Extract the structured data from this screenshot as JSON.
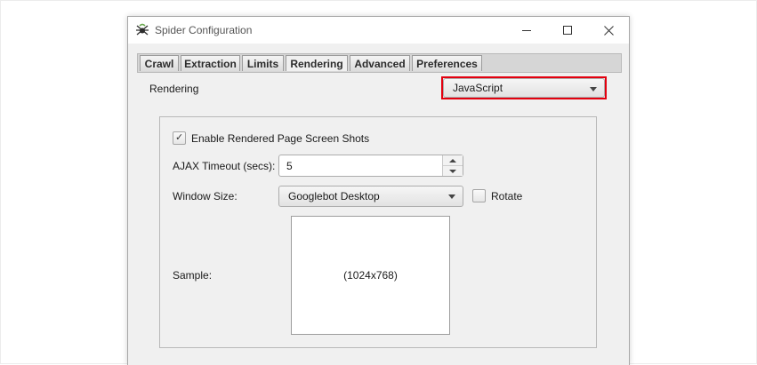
{
  "window": {
    "title": "Spider Configuration",
    "icon": "spider-icon"
  },
  "tabs": [
    {
      "label": "Crawl",
      "active": false
    },
    {
      "label": "Extraction",
      "active": false
    },
    {
      "label": "Limits",
      "active": false
    },
    {
      "label": "Rendering",
      "active": true
    },
    {
      "label": "Advanced",
      "active": false
    },
    {
      "label": "Preferences",
      "active": false
    }
  ],
  "rendering": {
    "label": "Rendering",
    "selected": "JavaScript",
    "highlight_color": "#e3000f"
  },
  "settings": {
    "screenshots_label": "Enable Rendered Page Screen Shots",
    "screenshots_checked": true,
    "ajax_label": "AJAX Timeout (secs):",
    "ajax_value": "5",
    "window_size_label": "Window Size:",
    "window_size_value": "Googlebot Desktop",
    "rotate_label": "Rotate",
    "rotate_checked": false,
    "sample_label": "Sample:",
    "sample_size": "(1024x768)"
  }
}
